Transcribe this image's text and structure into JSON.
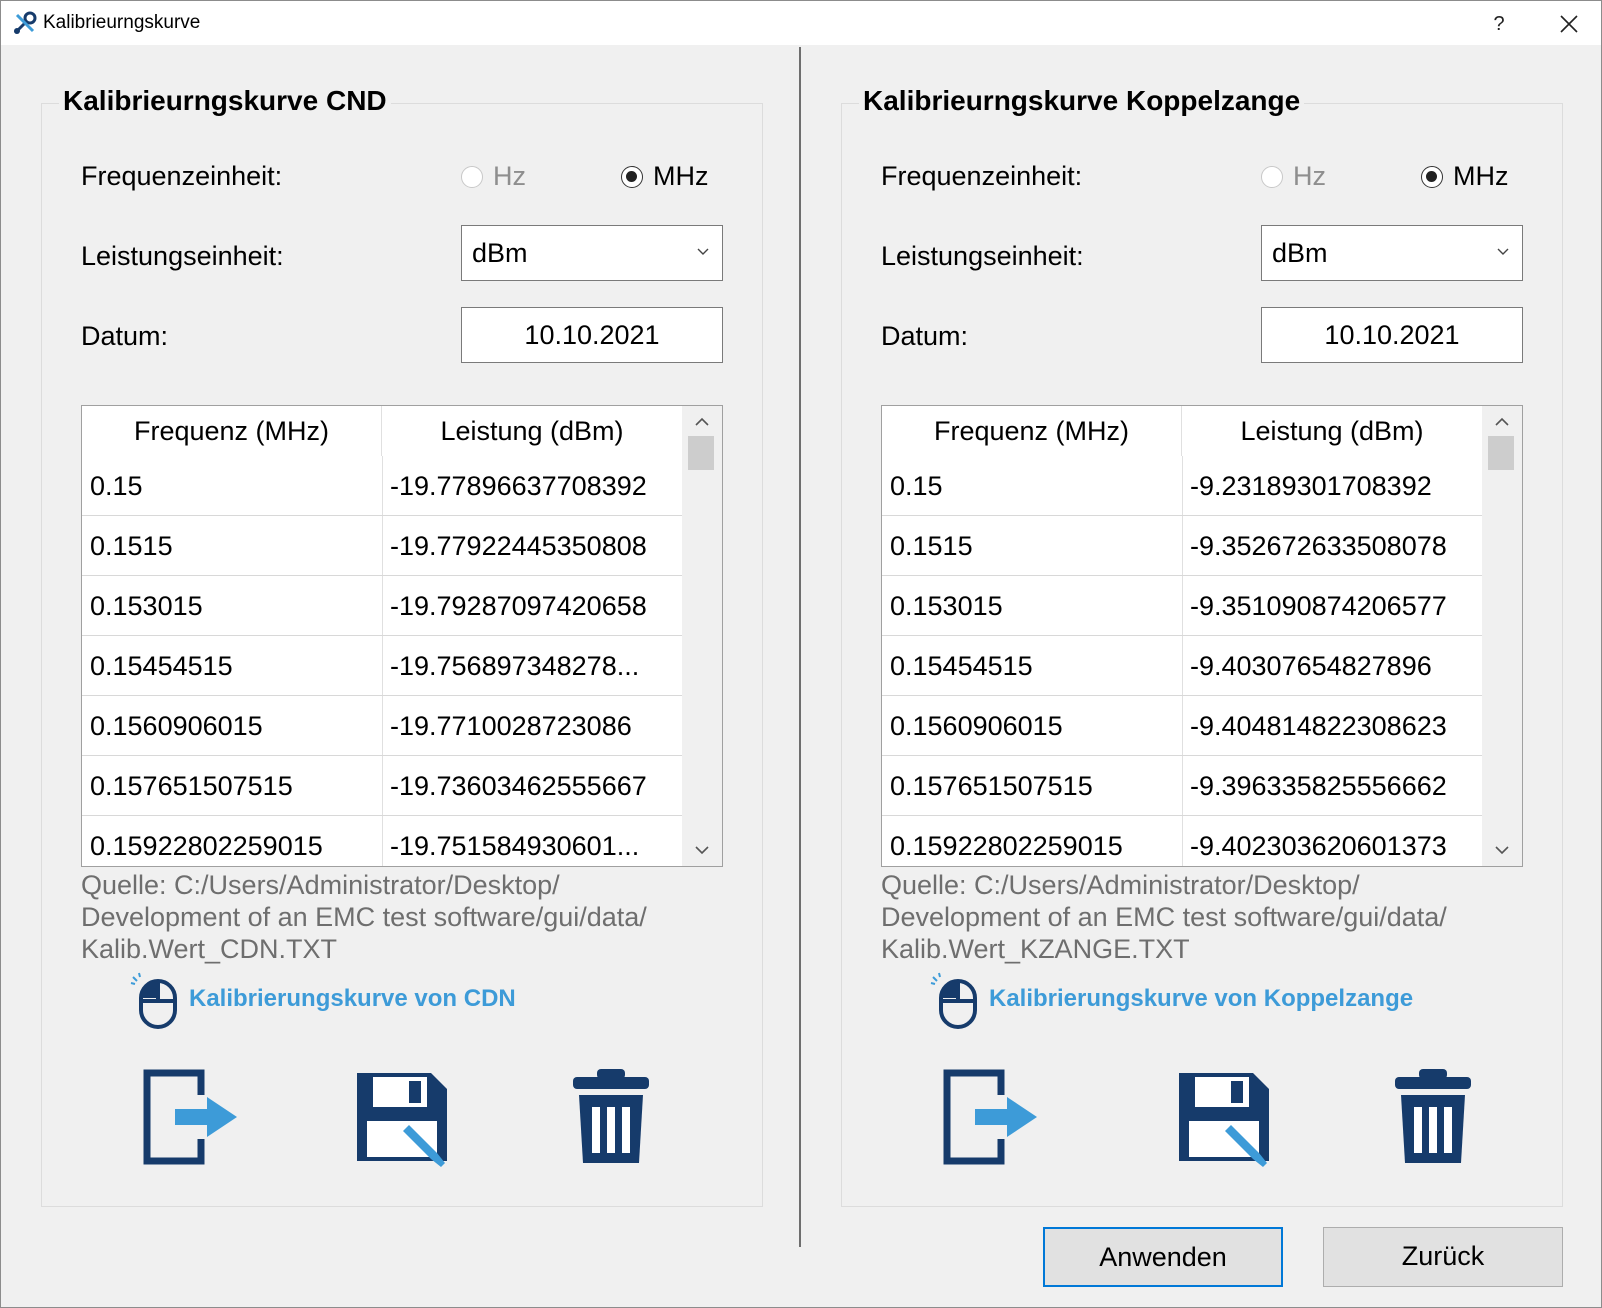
{
  "window": {
    "title": "Kalibrieurngskurve",
    "help_label": "?"
  },
  "colors": {
    "icon_dark_blue": "#163b6b",
    "icon_light_blue": "#3d9bd8",
    "link_blue": "#3d9bd8"
  },
  "left": {
    "group_title": "Kalibrieurngskurve CND",
    "freq_label": "Frequenzeinheit:",
    "freq_options": [
      "Hz",
      "MHz"
    ],
    "freq_selected": "MHz",
    "power_label": "Leistungseinheit:",
    "power_value": "dBm",
    "date_label": "Datum:",
    "date_value": "10.10.2021",
    "table": {
      "columns": [
        "Frequenz (MHz)",
        "Leistung (dBm)"
      ],
      "rows": [
        [
          "0.15",
          "-19.77896637708392"
        ],
        [
          "0.1515",
          "-19.77922445350808"
        ],
        [
          "0.153015",
          "-19.79287097420658"
        ],
        [
          "0.15454515",
          "-19.756897348278..."
        ],
        [
          "0.1560906015",
          "-19.7710028723086"
        ],
        [
          "0.157651507515",
          "-19.73603462555667"
        ],
        [
          "0.15922802259015",
          "-19.751584930601..."
        ]
      ]
    },
    "source_lines": [
      "Quelle: C:/Users/Administrator/Desktop/",
      "Development of an EMC test software/gui/data/",
      "Kalib.Wert_CDN.TXT"
    ],
    "link_text": "Kalibrierungskurve von CDN",
    "icons": [
      "import-icon",
      "save-icon",
      "trash-icon"
    ]
  },
  "right": {
    "group_title": "Kalibrieurngskurve Koppelzange",
    "freq_label": "Frequenzeinheit:",
    "freq_options": [
      "Hz",
      "MHz"
    ],
    "freq_selected": "MHz",
    "power_label": "Leistungseinheit:",
    "power_value": "dBm",
    "date_label": "Datum:",
    "date_value": "10.10.2021",
    "table": {
      "columns": [
        "Frequenz (MHz)",
        "Leistung (dBm)"
      ],
      "rows": [
        [
          "0.15",
          "-9.23189301708392"
        ],
        [
          "0.1515",
          "-9.352672633508078"
        ],
        [
          "0.153015",
          "-9.351090874206577"
        ],
        [
          "0.15454515",
          "-9.40307654827896"
        ],
        [
          "0.1560906015",
          "-9.404814822308623"
        ],
        [
          "0.157651507515",
          "-9.396335825556662"
        ],
        [
          "0.15922802259015",
          "-9.402303620601373"
        ]
      ]
    },
    "source_lines": [
      "Quelle: C:/Users/Administrator/Desktop/",
      "Development of an EMC test software/gui/data/",
      "Kalib.Wert_KZANGE.TXT"
    ],
    "link_text": "Kalibrierungskurve von Koppelzange",
    "icons": [
      "import-icon",
      "save-icon",
      "trash-icon"
    ]
  },
  "footer": {
    "apply_label": "Anwenden",
    "back_label": "Zurück"
  }
}
